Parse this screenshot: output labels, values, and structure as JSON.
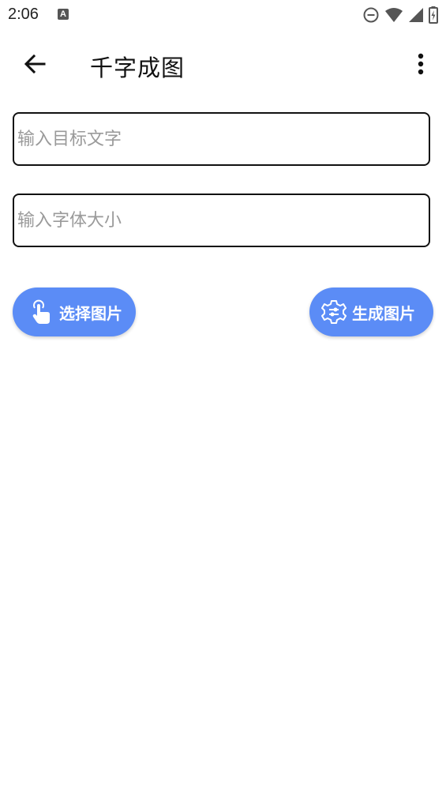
{
  "status_bar": {
    "time": "2:06",
    "notification_icon": "A"
  },
  "app_bar": {
    "title": "千字成图",
    "back_icon": "arrow-back-icon",
    "menu_icon": "more-vert-icon"
  },
  "form": {
    "target_text": {
      "placeholder": "输入目标文字",
      "value": ""
    },
    "font_size": {
      "placeholder": "输入字体大小",
      "value": ""
    }
  },
  "buttons": {
    "select_image": {
      "label": "选择图片",
      "icon": "touch-icon"
    },
    "generate_image": {
      "label": "生成图片",
      "icon": "settings-icon"
    }
  },
  "colors": {
    "accent": "#5b8cf6",
    "text": "#111111",
    "placeholder": "#9a9a9a",
    "border": "#111111"
  }
}
